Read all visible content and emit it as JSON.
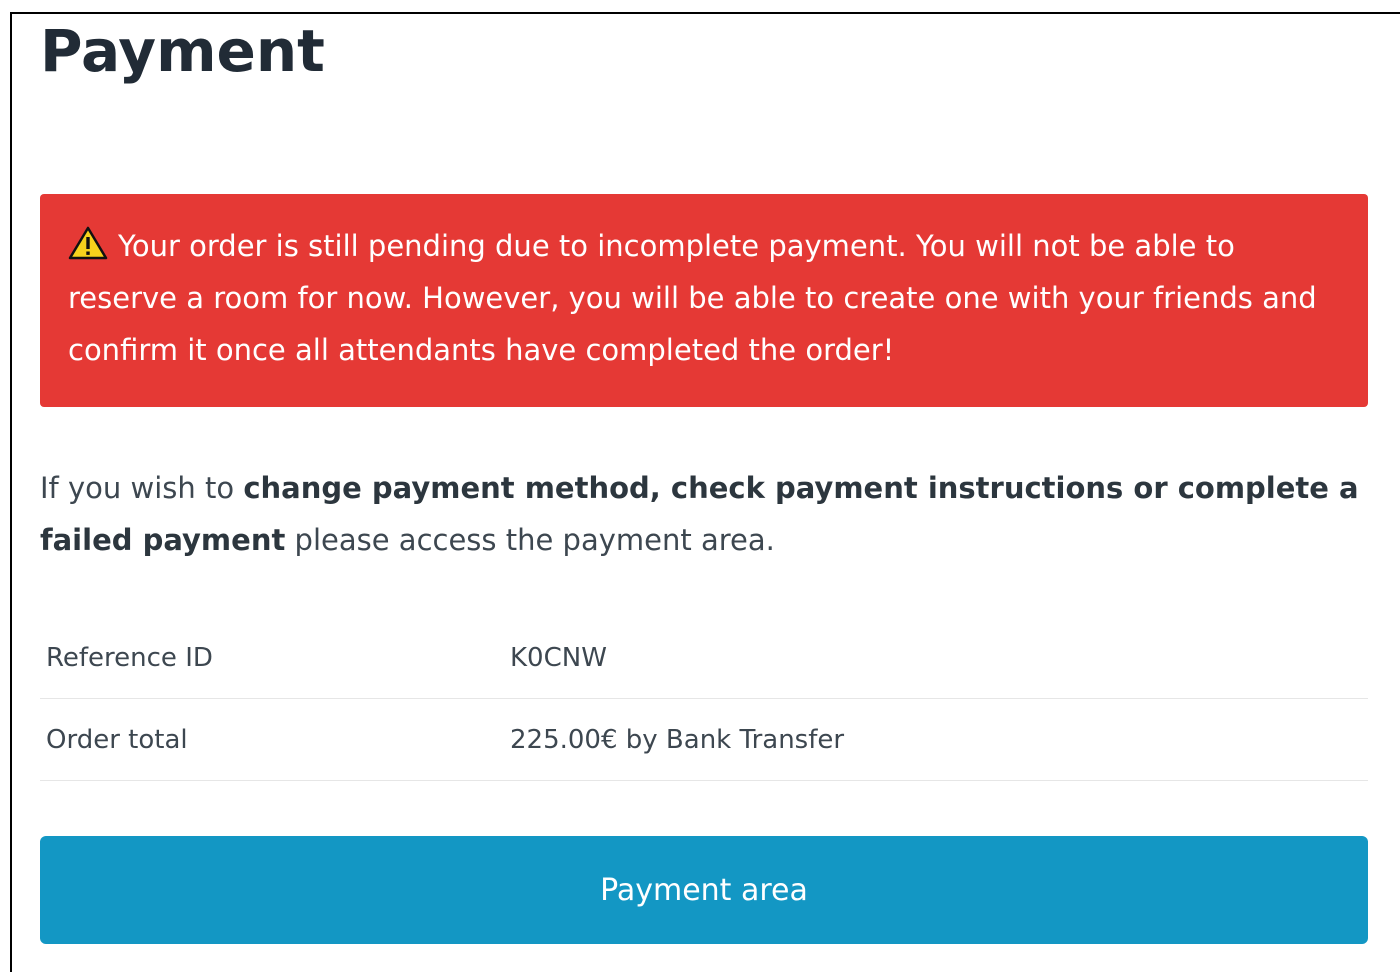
{
  "page": {
    "title": "Payment"
  },
  "alert": {
    "icon": "warning-icon",
    "color": "#e53935",
    "message": "Your order is still pending due to incomplete payment. You will not be able to reserve a room for now. However, you will be able to create one with your friends and confirm it once all attendants have completed the order!"
  },
  "info": {
    "prefix": "If you wish to ",
    "emphasis": "change payment method, check payment instructions or complete a failed payment",
    "suffix": " please access the payment area."
  },
  "details": {
    "rows": [
      {
        "label": "Reference ID",
        "value": "K0CNW"
      },
      {
        "label": "Order total",
        "value": "225.00€ by Bank Transfer"
      }
    ]
  },
  "actions": {
    "payment_area_label": "Payment area",
    "button_color": "#1397c4"
  }
}
